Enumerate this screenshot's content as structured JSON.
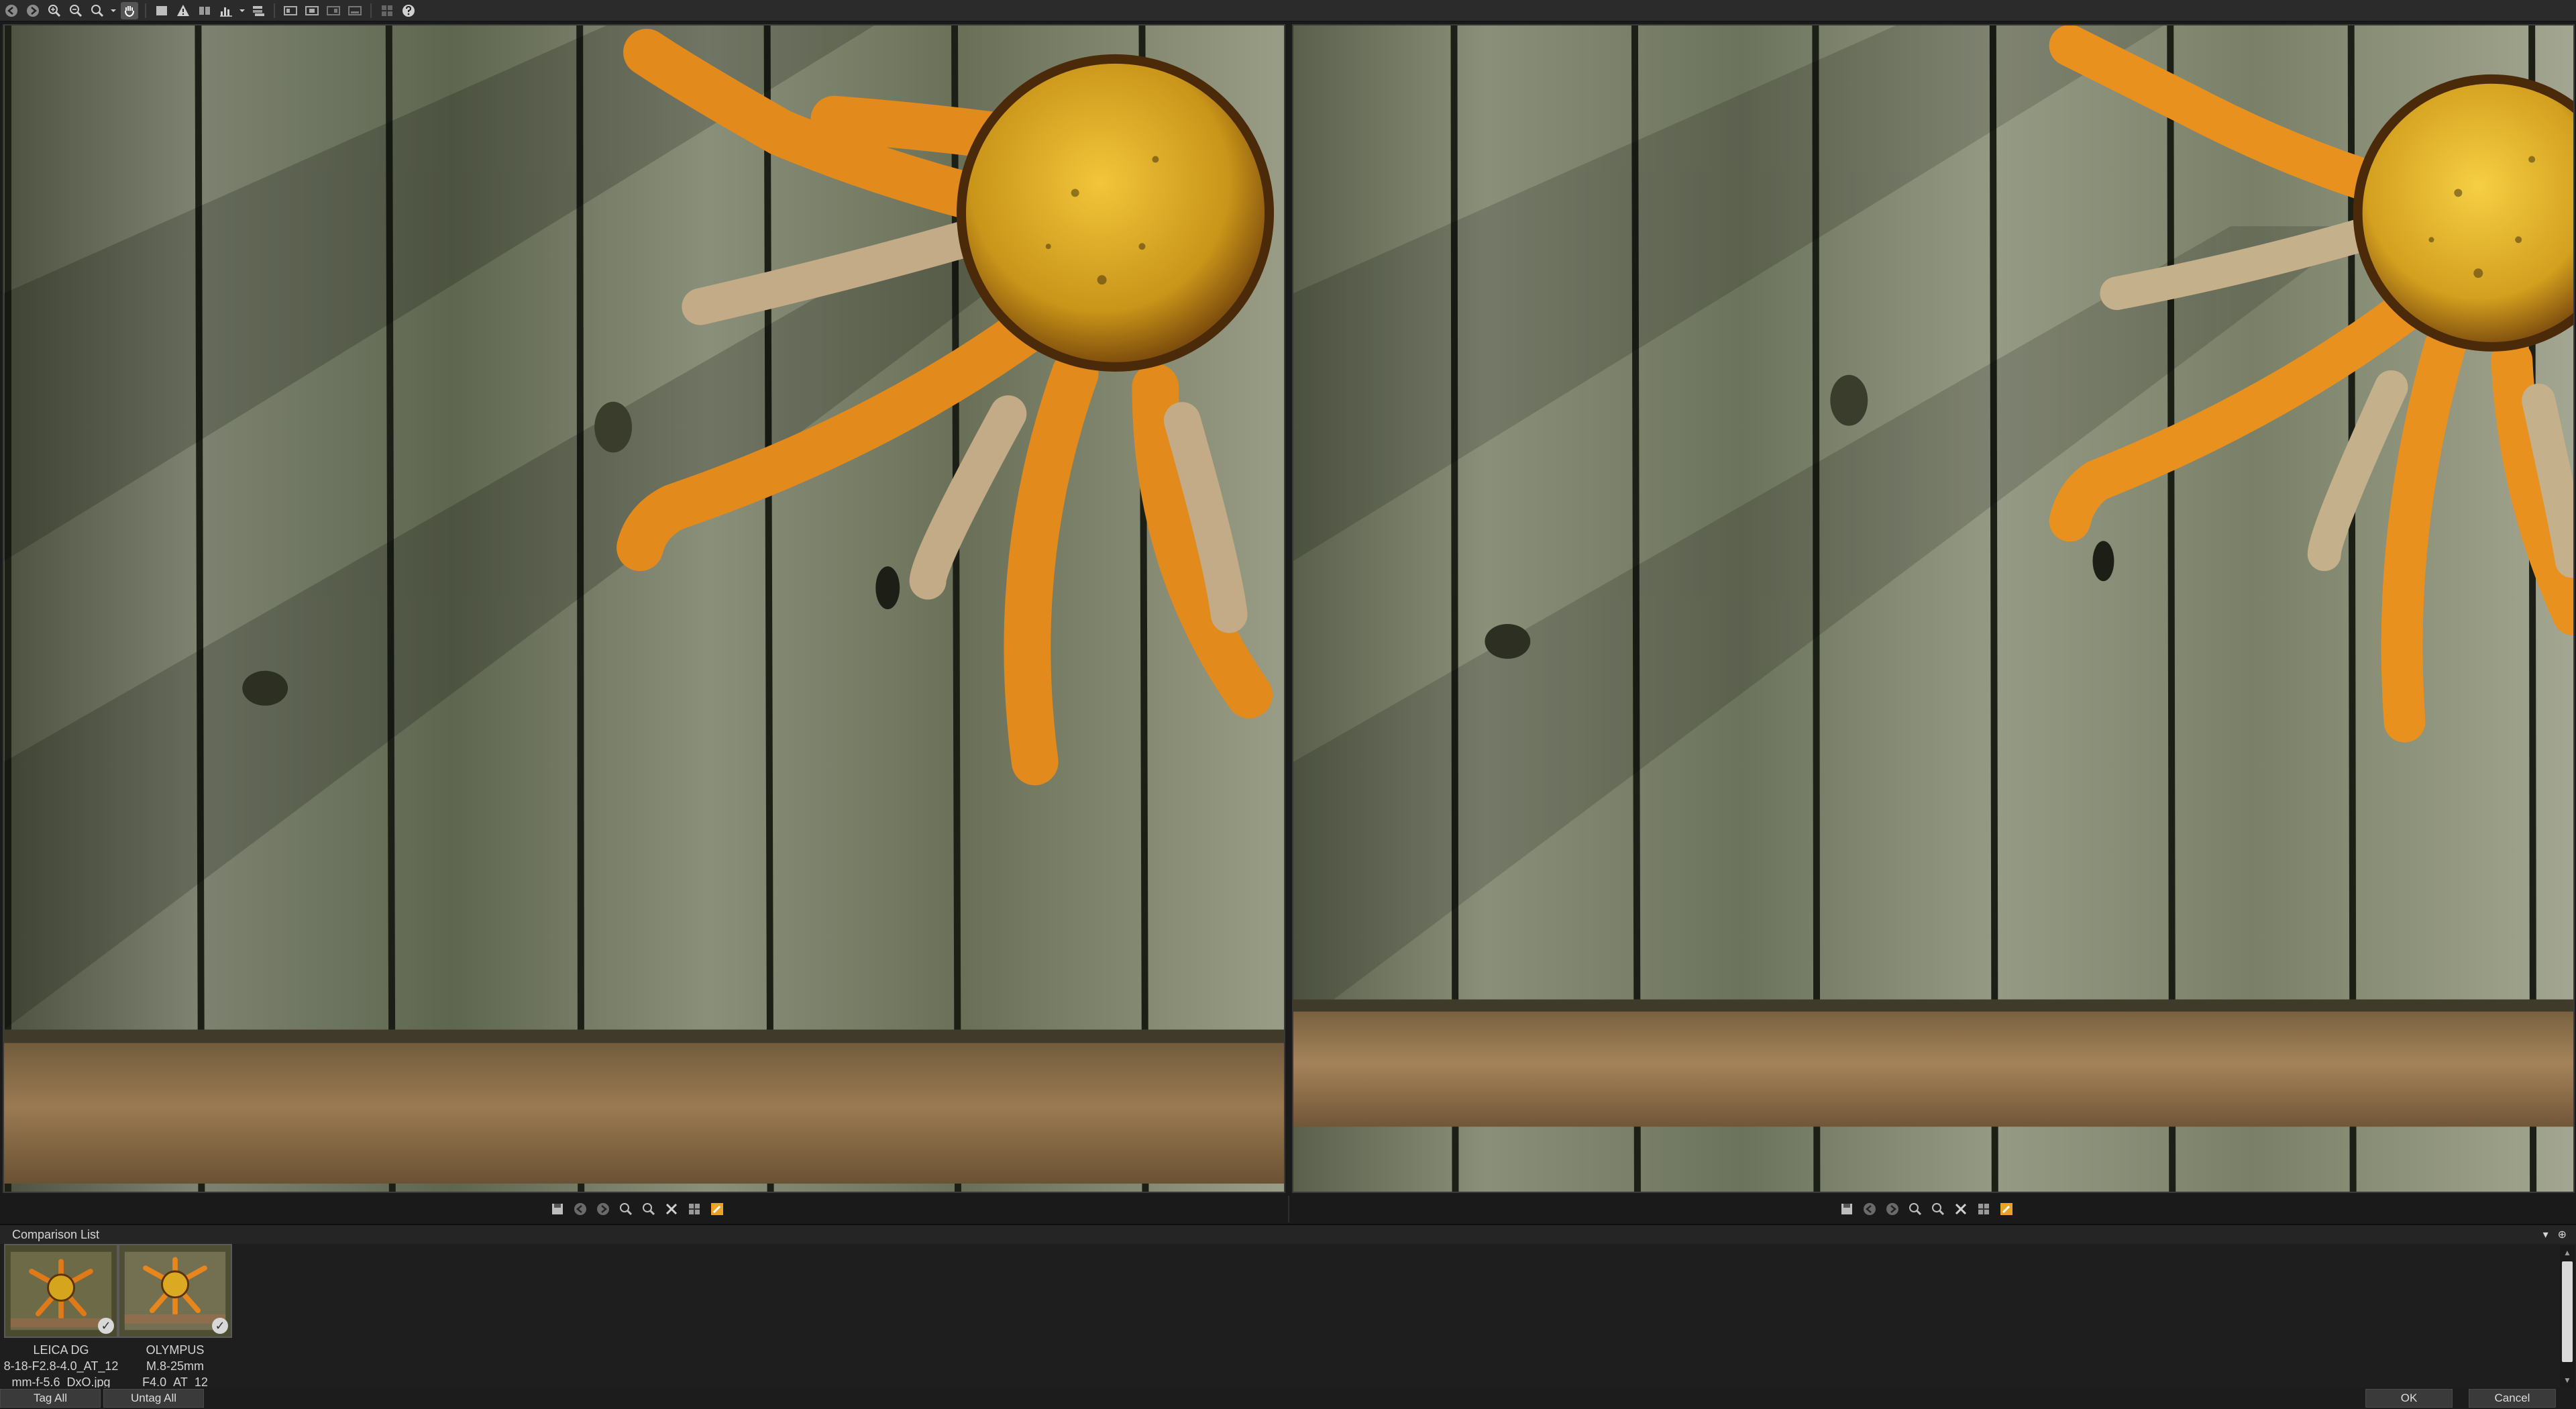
{
  "toolbar": {
    "icons": [
      "back-icon",
      "forward-icon",
      "zoom-in-icon",
      "zoom-out-icon",
      "zoom-fit-icon",
      "zoom-menu-icon",
      "hand-tool-icon",
      "single-view-icon",
      "warning-icon",
      "compare-view-icon",
      "histogram-icon",
      "histogram-menu-icon",
      "stack-icon",
      "pane-layout-1-icon",
      "pane-layout-2-icon",
      "pane-layout-3-icon",
      "pane-layout-4-icon",
      "grid-icon",
      "help-icon"
    ]
  },
  "pane_toolbar": {
    "icons": [
      "save-icon",
      "previous-icon",
      "next-icon",
      "zoom-in-icon",
      "zoom-out-icon",
      "close-icon",
      "compare-icon",
      "edit-icon"
    ]
  },
  "comparison_list": {
    "title": "Comparison List",
    "items": [
      {
        "line1": "LEICA DG",
        "line2": "8-18-F2.8-4.0_AT_12",
        "line3": "mm-f-5.6_DxO.jpg",
        "checked": true
      },
      {
        "line1": "OLYMPUS",
        "line2": "M.8-25mm",
        "line3": "F4.0_AT_12",
        "checked": true
      }
    ],
    "pin_label": "▾  ⊕"
  },
  "buttons": {
    "tag_all": "Tag All",
    "untag_all": "Untag All",
    "ok": "OK",
    "cancel": "Cancel"
  },
  "colors": {
    "background": "#1a1a1a",
    "toolbar": "#2b2b2b",
    "wood": "#6b7158",
    "sun_core": "#d6a51e",
    "ray_orange": "#e8731a",
    "board": "#8a6a48"
  }
}
